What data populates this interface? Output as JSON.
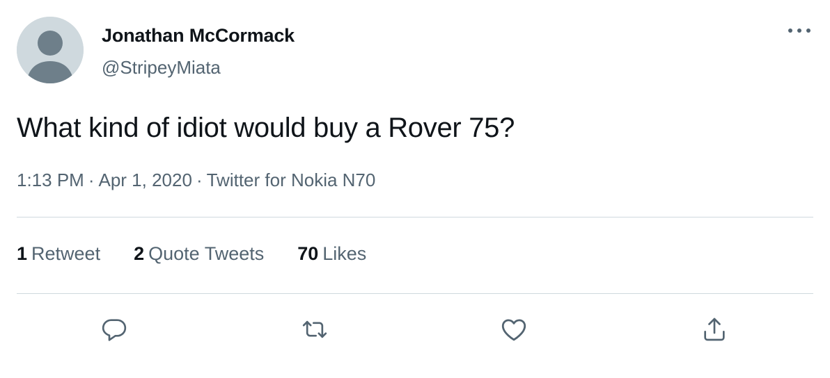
{
  "author": {
    "display_name": "Jonathan McCormack",
    "handle": "@StripeyMiata",
    "avatar_icon": "default-profile-icon"
  },
  "tweet": {
    "text": "What kind of idiot would buy a Rover 75?",
    "time": "1:13 PM",
    "date": "Apr 1, 2020",
    "source": "Twitter for Nokia N70",
    "separator": "·"
  },
  "stats": {
    "retweets": {
      "count": "1",
      "label": "Retweet"
    },
    "quotes": {
      "count": "2",
      "label": "Quote Tweets"
    },
    "likes": {
      "count": "70",
      "label": "Likes"
    }
  },
  "actions": [
    {
      "name": "reply",
      "icon": "reply-icon"
    },
    {
      "name": "retweet",
      "icon": "retweet-icon"
    },
    {
      "name": "like",
      "icon": "heart-icon"
    },
    {
      "name": "share",
      "icon": "share-icon"
    }
  ],
  "colors": {
    "text_primary": "#0f1419",
    "text_secondary": "#536471",
    "divider": "#cfd9de",
    "avatar_bg": "#cfd9de",
    "avatar_fg": "#6e7f8a"
  }
}
